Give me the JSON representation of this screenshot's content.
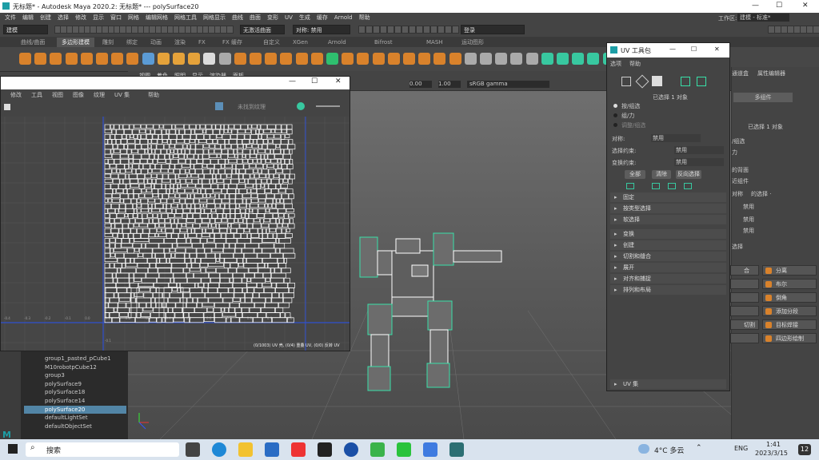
{
  "window": {
    "title": "无标题* - Autodesk Maya 2020.2: 无标题*   ---   polySurface20",
    "min": "—",
    "max": "☐",
    "close": "✕"
  },
  "menus": [
    "文件",
    "编辑",
    "创建",
    "选择",
    "修改",
    "显示",
    "窗口",
    "网格",
    "编辑网格",
    "网格工具",
    "网格显示",
    "曲线",
    "曲面",
    "变形",
    "UV",
    "生成",
    "缓存",
    "Arnold",
    "帮助"
  ],
  "workspace": {
    "label": "工作区:",
    "value": "建模 - 标准*"
  },
  "statusline": {
    "mode": "建模",
    "no_live": "无激活曲面",
    "symmetry": "对称: 禁用",
    "login": "登录"
  },
  "shelf_tabs": [
    "曲线/曲面",
    "多边形建模",
    "雕刻",
    "绑定",
    "动画",
    "渲染",
    "FX",
    "FX 缓存",
    "自定义",
    "XGen",
    "Arnold",
    "Bifrost",
    "MASH",
    "运动图形"
  ],
  "viewport": {
    "menus": [
      "视图",
      "着色",
      "照明",
      "显示",
      "渲染器",
      "面板"
    ],
    "num1": "0.00",
    "num2": "1.00",
    "colorspace": "sRGB gamma"
  },
  "uv_editor": {
    "menus": [
      "修改",
      "工具",
      "视图",
      "图像",
      "纹理",
      "UV 集",
      "帮助"
    ],
    "uvset": "未找到纹理",
    "status": "(0/1003) UV 壳, (0/4) 重叠 UV, (0/0) 反转 UV",
    "ticks_x": [
      "-0.4",
      "-0.3",
      "-0.2",
      "-0.1",
      "0.0",
      "0.1",
      "0.2",
      "0.3",
      "0.4",
      "0.5",
      "0.6",
      "0.7",
      "0.8",
      "0.9",
      "1.0"
    ],
    "tick_y": "-0.1"
  },
  "uv_toolkit": {
    "title": "UV 工具包",
    "menus": [
      "选项",
      "帮助"
    ],
    "selected": "已选择 1 对象",
    "radios": [
      "按/组选",
      "组/力",
      "调整/组选"
    ],
    "fields": [
      {
        "label": "对称:",
        "value": "禁用"
      },
      {
        "label": "选择约束:",
        "value": "禁用"
      },
      {
        "label": "变换约束:",
        "value": "禁用"
      }
    ],
    "buttons": [
      "全部",
      "清除",
      "反向选择"
    ],
    "sections": [
      "固定",
      "按类型选择",
      "软选择",
      "变换",
      "创建",
      "切割和缝合",
      "展开",
      "对齐和捕捉",
      "排列和布局"
    ],
    "uvset": "UV 集"
  },
  "right_panel": {
    "tabs": [
      "通道盒",
      "属性编辑器"
    ],
    "multi": "多组件",
    "selected": "已选择 1 对象",
    "lines": [
      "/组选",
      "力",
      "的背面",
      "近组件",
      "对称",
      "的选择 ·",
      "禁用",
      "禁用",
      "禁用",
      "选择"
    ],
    "buttons": [
      [
        "合",
        "分离"
      ],
      [
        "",
        "布尔"
      ],
      [
        "",
        "倒角"
      ],
      [
        "",
        "添加分段"
      ],
      [
        "切割",
        "目标焊接"
      ],
      [
        "",
        "四边形绘制"
      ]
    ]
  },
  "outliner": [
    "group1_pasted_pCube1",
    "M10robotpCube12",
    "group3",
    "polySurface9",
    "polySurface18",
    "polySurface14",
    "polySurface20",
    "defaultLightSet",
    "defaultObjectSet"
  ],
  "outliner_selected_index": 6,
  "taskbar": {
    "search": "搜索",
    "weather": "4°C  多云",
    "lang": "ENG",
    "time": "1:41",
    "date": "2023/3/15",
    "badge": "12"
  },
  "colors": {
    "selection": "#5285a6",
    "accent_green": "#38e0a8",
    "wire": "#ffffff"
  }
}
